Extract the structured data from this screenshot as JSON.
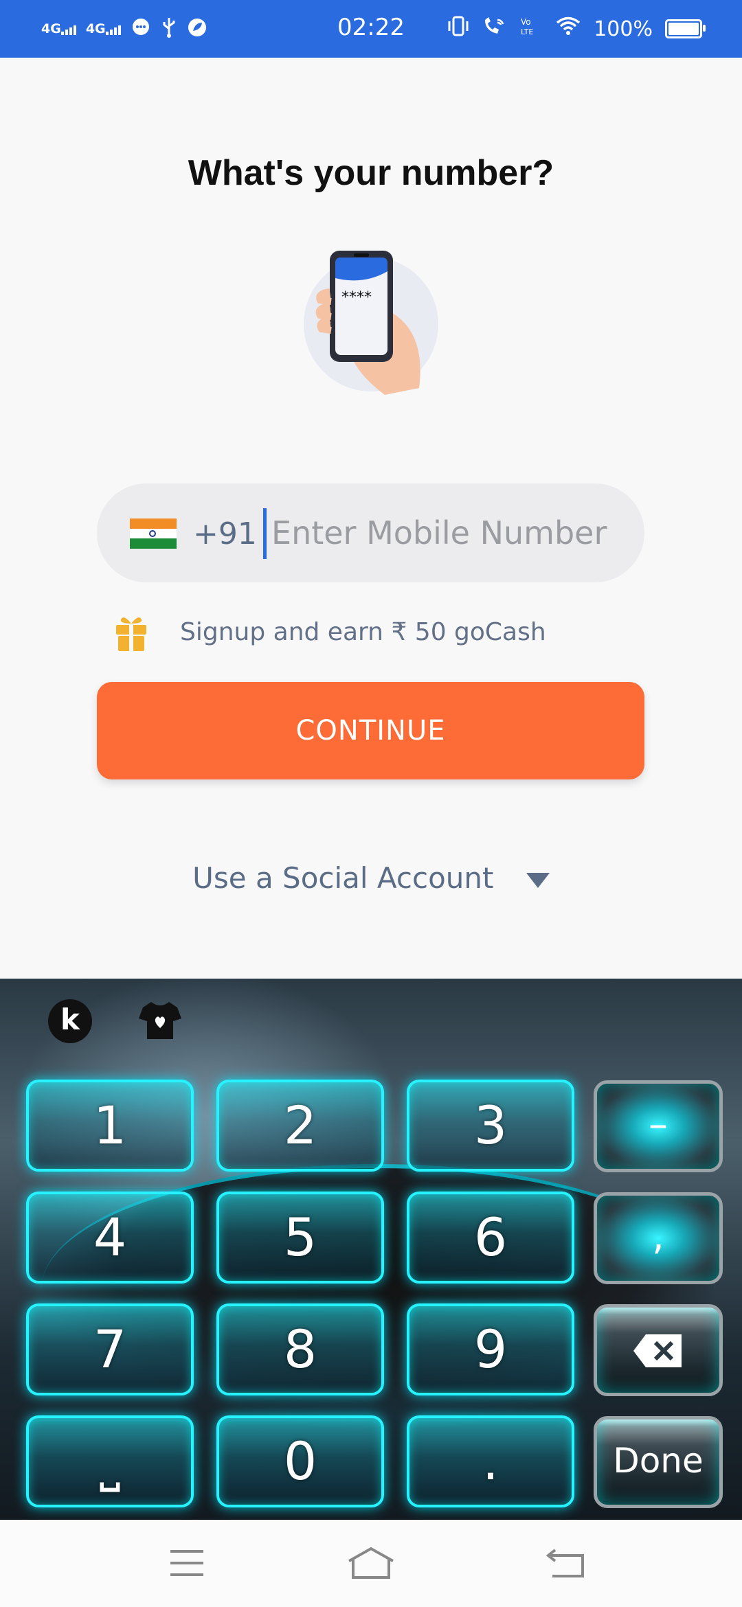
{
  "colors": {
    "accent": "#2a6be0",
    "button": "#fd6b36",
    "muted_text": "#5a6c86",
    "glow": "#27f2ff"
  },
  "status_bar": {
    "network1": "4G",
    "network2": "4G",
    "time": "02:22",
    "battery": "100%",
    "icons": [
      "message-icon",
      "usb-icon",
      "leaf-icon",
      "vibrate-icon",
      "wifi-calling-icon",
      "volte-icon",
      "wifi-icon",
      "battery-icon"
    ]
  },
  "main": {
    "title": "What's your number?",
    "illustration": "phone-in-hand-illustration",
    "phone_field": {
      "country_code": "+91",
      "placeholder": "Enter Mobile Number",
      "value": ""
    },
    "promo": "Signup and earn ₹ 50 goCash",
    "continue_label": "CONTINUE",
    "social_label": "Use a Social Account"
  },
  "keyboard": {
    "keys": {
      "k1": "1",
      "k2": "2",
      "k3": "3",
      "k4": "4",
      "k5": "5",
      "k6": "6",
      "k7": "7",
      "k8": "8",
      "k9": "9",
      "k0": "0",
      "space": "⎵",
      "dot": ".",
      "minus": "–",
      "comma": ",",
      "done": "Done"
    },
    "backspace_icon": "backspace-icon"
  },
  "navbar": {
    "icons": [
      "menu-icon",
      "home-icon",
      "back-icon"
    ]
  }
}
